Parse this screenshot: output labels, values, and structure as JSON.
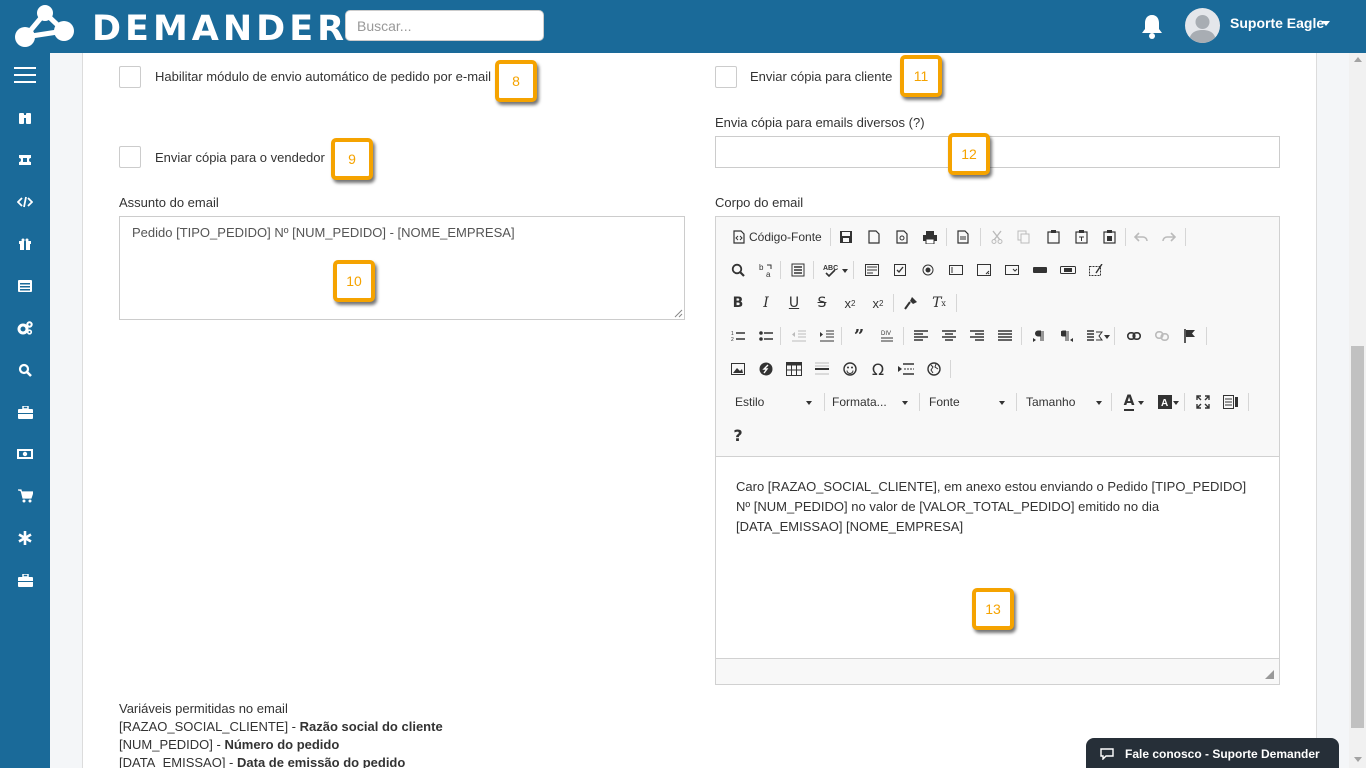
{
  "header": {
    "logo_text": "DEMANDER",
    "search_placeholder": "Buscar...",
    "user_name": "Suporte Eagle"
  },
  "sidebar": {
    "items": [
      "menu-icon",
      "binoculars-icon",
      "ticket-icon",
      "code-icon",
      "gift-icon",
      "list-icon",
      "cogs-icon",
      "search-icon",
      "briefcase-icon",
      "money-icon",
      "cart-icon",
      "asterisk-icon",
      "toolbox-icon"
    ]
  },
  "form": {
    "auto_send_label": "Habilitar módulo de envio automático de pedido por e-mail",
    "copy_seller_label": "Enviar cópia para o vendedor",
    "copy_client_label": "Enviar cópia para cliente",
    "other_emails_label": "Envia cópia para emails diversos (?)",
    "subject_label": "Assunto do email",
    "subject_value": "Pedido [TIPO_PEDIDO] Nº [NUM_PEDIDO] - [NOME_EMPRESA]",
    "body_label": "Corpo do email",
    "body_text": "Caro [RAZAO_SOCIAL_CLIENTE], em anexo estou enviando o Pedido [TIPO_PEDIDO] Nº [NUM_PEDIDO] no valor de [VALOR_TOTAL_PEDIDO] emitido no dia [DATA_EMISSAO] [NOME_EMPRESA]"
  },
  "editor": {
    "source_label": "Código-Fonte",
    "style_label": "Estilo",
    "format_label": "Formata...",
    "font_label": "Fonte",
    "size_label": "Tamanho",
    "help_label": "?"
  },
  "badges": [
    "8",
    "9",
    "10",
    "11",
    "12",
    "13"
  ],
  "variables": {
    "title": "Variáveis permitidas no email",
    "items": [
      {
        "key": "[RAZAO_SOCIAL_CLIENTE]",
        "desc": "Razão social do cliente"
      },
      {
        "key": "[NUM_PEDIDO]",
        "desc": "Número do pedido"
      },
      {
        "key": "[DATA_EMISSAO]",
        "desc": "Data de emissão do pedido"
      }
    ]
  },
  "chat": {
    "label": "Fale conosco - Suporte Demander"
  },
  "colors": {
    "primary": "#1a6a99",
    "badge": "#f5a300",
    "chat": "#262f38"
  }
}
